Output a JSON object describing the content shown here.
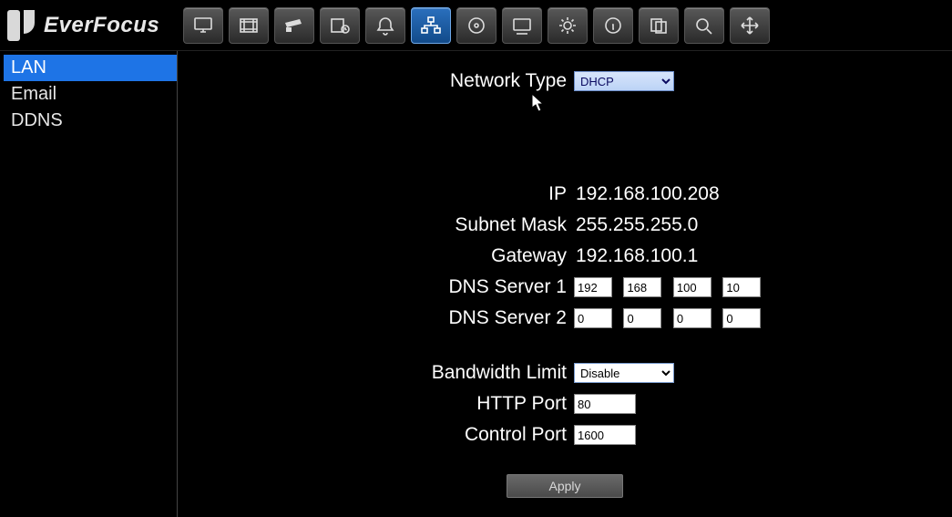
{
  "brand": {
    "name": "EverFocus"
  },
  "toolbar_icons": [
    "monitor-icon",
    "film-icon",
    "camera-icon",
    "schedule-icon",
    "alarm-icon",
    "network-icon",
    "disk-icon",
    "display-icon",
    "system-icon",
    "info-icon",
    "copy-icon",
    "search-icon",
    "arrows-icon"
  ],
  "toolbar_active_index": 5,
  "sidebar": {
    "items": [
      {
        "label": "LAN",
        "selected": true
      },
      {
        "label": "Email",
        "selected": false
      },
      {
        "label": "DDNS",
        "selected": false
      }
    ]
  },
  "form": {
    "network_type_label": "Network Type",
    "network_type_value": "DHCP",
    "ip_label": "IP",
    "ip_value": "192.168.100.208",
    "subnet_label": "Subnet Mask",
    "subnet_value": "255.255.255.0",
    "gateway_label": "Gateway",
    "gateway_value": "192.168.100.1",
    "dns1_label": "DNS Server 1",
    "dns1": {
      "a": "192",
      "b": "168",
      "c": "100",
      "d": "10"
    },
    "dns2_label": "DNS Server 2",
    "dns2": {
      "a": "0",
      "b": "0",
      "c": "0",
      "d": "0"
    },
    "bw_label": "Bandwidth Limit",
    "bw_value": "Disable",
    "http_label": "HTTP Port",
    "http_value": "80",
    "ctrl_label": "Control Port",
    "ctrl_value": "1600",
    "apply_label": "Apply"
  }
}
